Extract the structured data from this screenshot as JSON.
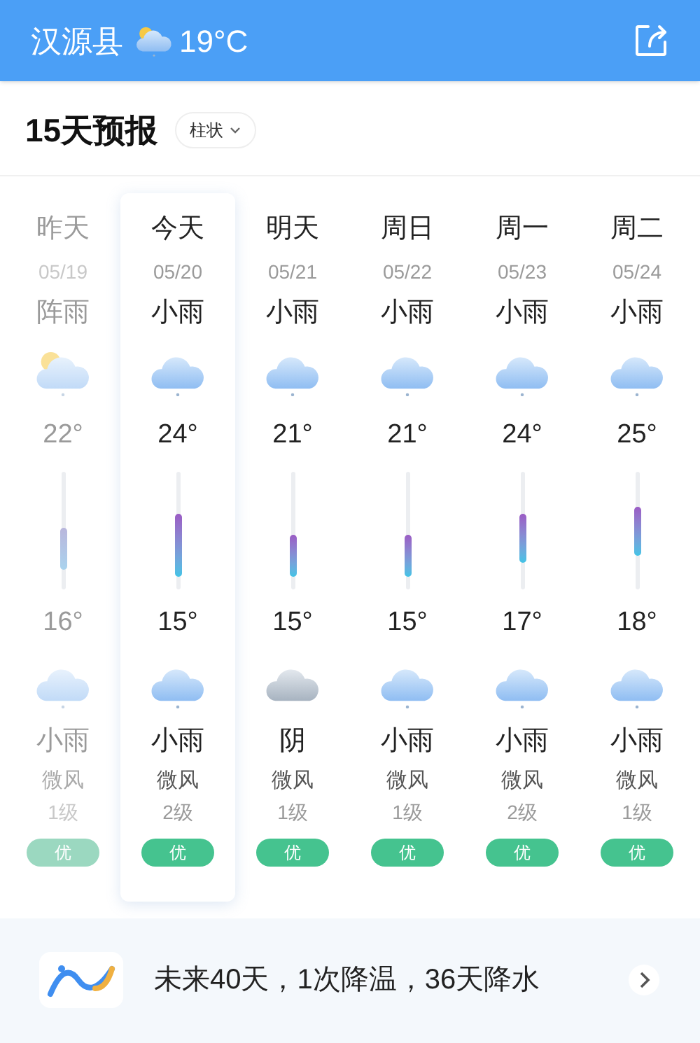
{
  "header": {
    "city": "汉源县",
    "weather_icon": {
      "kind": "sun-cloud"
    },
    "temperature": "19°C"
  },
  "forecast": {
    "title": "15天预报",
    "view_toggle": "柱状",
    "days": [
      {
        "label": "昨天",
        "date": "05/19",
        "day_weather": "阵雨",
        "day_icon": {
          "kind": "sun-cloud"
        },
        "high": "22°",
        "low": "16°",
        "night_icon": {
          "kind": "rain"
        },
        "night_weather": "小雨",
        "wind": "微风",
        "wind_level": "1级",
        "aqi": "优",
        "past": true,
        "selected": false
      },
      {
        "label": "今天",
        "date": "05/20",
        "day_weather": "小雨",
        "day_icon": {
          "kind": "rain"
        },
        "high": "24°",
        "low": "15°",
        "night_icon": {
          "kind": "rain"
        },
        "night_weather": "小雨",
        "wind": "微风",
        "wind_level": "2级",
        "aqi": "优",
        "past": false,
        "selected": true
      },
      {
        "label": "明天",
        "date": "05/21",
        "day_weather": "小雨",
        "day_icon": {
          "kind": "rain"
        },
        "high": "21°",
        "low": "15°",
        "night_icon": {
          "kind": "overcast"
        },
        "night_weather": "阴",
        "wind": "微风",
        "wind_level": "1级",
        "aqi": "优",
        "past": false,
        "selected": false
      },
      {
        "label": "周日",
        "date": "05/22",
        "day_weather": "小雨",
        "day_icon": {
          "kind": "rain"
        },
        "high": "21°",
        "low": "15°",
        "night_icon": {
          "kind": "rain"
        },
        "night_weather": "小雨",
        "wind": "微风",
        "wind_level": "1级",
        "aqi": "优",
        "past": false,
        "selected": false
      },
      {
        "label": "周一",
        "date": "05/23",
        "day_weather": "小雨",
        "day_icon": {
          "kind": "rain"
        },
        "high": "24°",
        "low": "17°",
        "night_icon": {
          "kind": "rain"
        },
        "night_weather": "小雨",
        "wind": "微风",
        "wind_level": "2级",
        "aqi": "优",
        "past": false,
        "selected": false
      },
      {
        "label": "周二",
        "date": "05/24",
        "day_weather": "小雨",
        "day_icon": {
          "kind": "rain"
        },
        "high": "25°",
        "low": "18°",
        "night_icon": {
          "kind": "rain"
        },
        "night_weather": "小雨",
        "wind": "微风",
        "wind_level": "1级",
        "aqi": "优",
        "past": false,
        "selected": false
      }
    ]
  },
  "outlook": {
    "text": "未来40天，1次降温，36天降水"
  }
}
